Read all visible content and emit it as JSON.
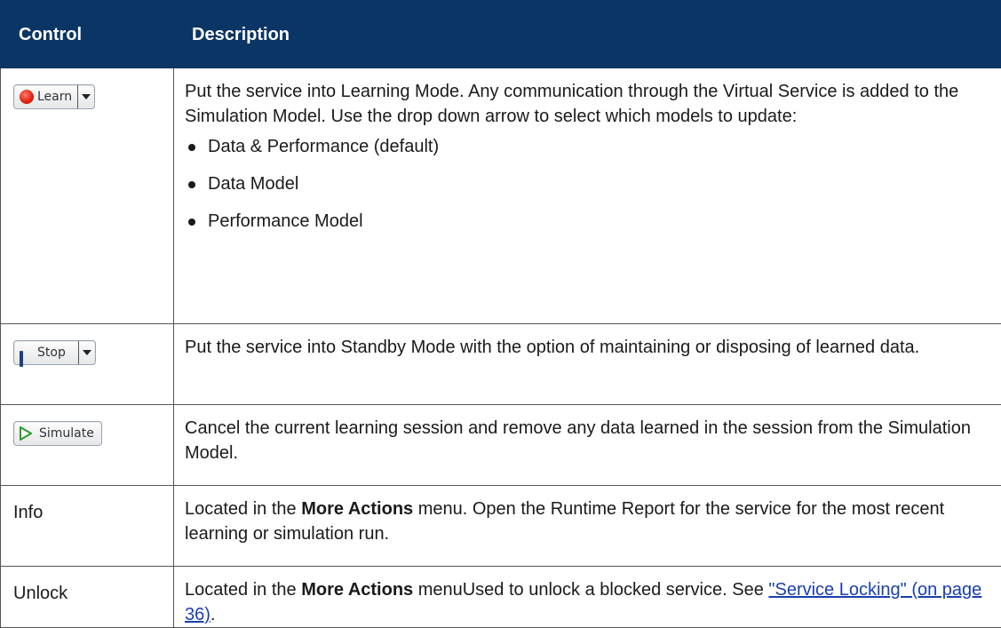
{
  "header": {
    "col1": "Control",
    "col2": "Description"
  },
  "rows": {
    "learn": {
      "button_label": "Learn",
      "icon": "record-icon",
      "description": "Put the service into Learning Mode. Any communication through the Virtual Service is added to the Simulation Model. Use the drop down arrow to select which models to update:",
      "bullets": [
        "Data & Performance (default)",
        "Data Model",
        "Performance Model"
      ]
    },
    "stop": {
      "button_label": "Stop",
      "icon": "pause-icon",
      "description": "Put the service into Standby Mode with the option of maintaining or disposing of learned data."
    },
    "simulate": {
      "button_label": "Simulate",
      "icon": "play-icon",
      "description": "Cancel the current learning session and remove any data learned in the session from the Simulation Model."
    },
    "info": {
      "control": "Info",
      "desc_pre": "Located in the ",
      "desc_bold": "More Actions",
      "desc_post": " menu. Open the Runtime Report for the service for the most recent learning or simulation run."
    },
    "unlock": {
      "control": "Unlock",
      "desc_pre": "Located in the ",
      "desc_bold": "More Actions",
      "desc_mid": " menuUsed to unlock a blocked service. See ",
      "link_text": "\"Service Locking\" (on page 36)",
      "desc_post": "."
    }
  },
  "colors": {
    "header_bg": "#0b3565",
    "link": "#1a3fae",
    "record": "#e02010",
    "pause": "#2a5db8",
    "play": "#2a9a2a"
  }
}
